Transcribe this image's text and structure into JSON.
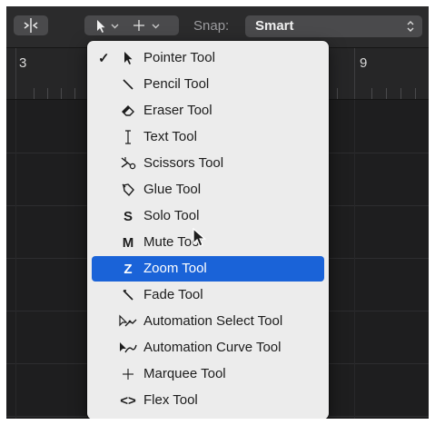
{
  "toolbar": {
    "snap_label": "Snap:",
    "snap_value": "Smart"
  },
  "ruler": {
    "bar_left": "3",
    "bar_right": "9"
  },
  "menu": {
    "selected_index": 0,
    "highlight_index": 8,
    "items": [
      {
        "label": "Pointer Tool",
        "icon": "pointer-icon",
        "checked": true
      },
      {
        "label": "Pencil Tool",
        "icon": "pencil-icon"
      },
      {
        "label": "Eraser Tool",
        "icon": "eraser-icon"
      },
      {
        "label": "Text Tool",
        "icon": "text-cursor-icon"
      },
      {
        "label": "Scissors Tool",
        "icon": "scissors-icon"
      },
      {
        "label": "Glue Tool",
        "icon": "glue-icon"
      },
      {
        "label": "Solo Tool",
        "icon": "solo-icon",
        "glyph": "S"
      },
      {
        "label": "Mute Tool",
        "icon": "mute-icon",
        "glyph": "M"
      },
      {
        "label": "Zoom Tool",
        "icon": "zoom-icon",
        "glyph": "Z"
      },
      {
        "label": "Fade Tool",
        "icon": "fade-icon"
      },
      {
        "label": "Automation Select Tool",
        "icon": "automation-select-icon"
      },
      {
        "label": "Automation Curve Tool",
        "icon": "automation-curve-icon"
      },
      {
        "label": "Marquee Tool",
        "icon": "marquee-icon"
      },
      {
        "label": "Flex Tool",
        "icon": "flex-icon",
        "glyph": "<>"
      }
    ],
    "check_glyph": "✓"
  },
  "colors": {
    "highlight": "#1a63d8",
    "menu_bg": "#ececec",
    "window_bg": "#1e1e1f"
  }
}
